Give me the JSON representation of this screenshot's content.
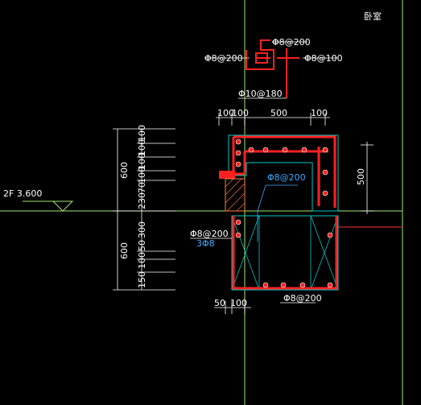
{
  "room_label": "卧室",
  "floor_level": "2F  3.600",
  "rebar": {
    "top_a": "Φ8@200",
    "top_left": "Φ8@200",
    "top_right": "Φ8@100",
    "bar_10": "Φ10@180",
    "mid": "Φ8@200",
    "left": "Φ8@200",
    "left_sub": "3Φ8",
    "bottom": "Φ8@200"
  },
  "dims": {
    "top": [
      "100",
      "100",
      "500",
      "100"
    ],
    "left_top_total": "600",
    "left_top_parts": [
      "100",
      "100",
      "100",
      "100",
      "70",
      "230"
    ],
    "left_bottom_total": "600",
    "left_bottom_parts": [
      "300",
      "50",
      "100",
      "150"
    ],
    "right": "500",
    "bottom": [
      "50",
      "100"
    ]
  },
  "colors": {
    "background": "#000000",
    "concrete_outline": "#00c8c8",
    "rebar": "#ff2020",
    "dimension": "#ffffff",
    "label": "#3fa9ff",
    "level_line": "#9fe870"
  }
}
